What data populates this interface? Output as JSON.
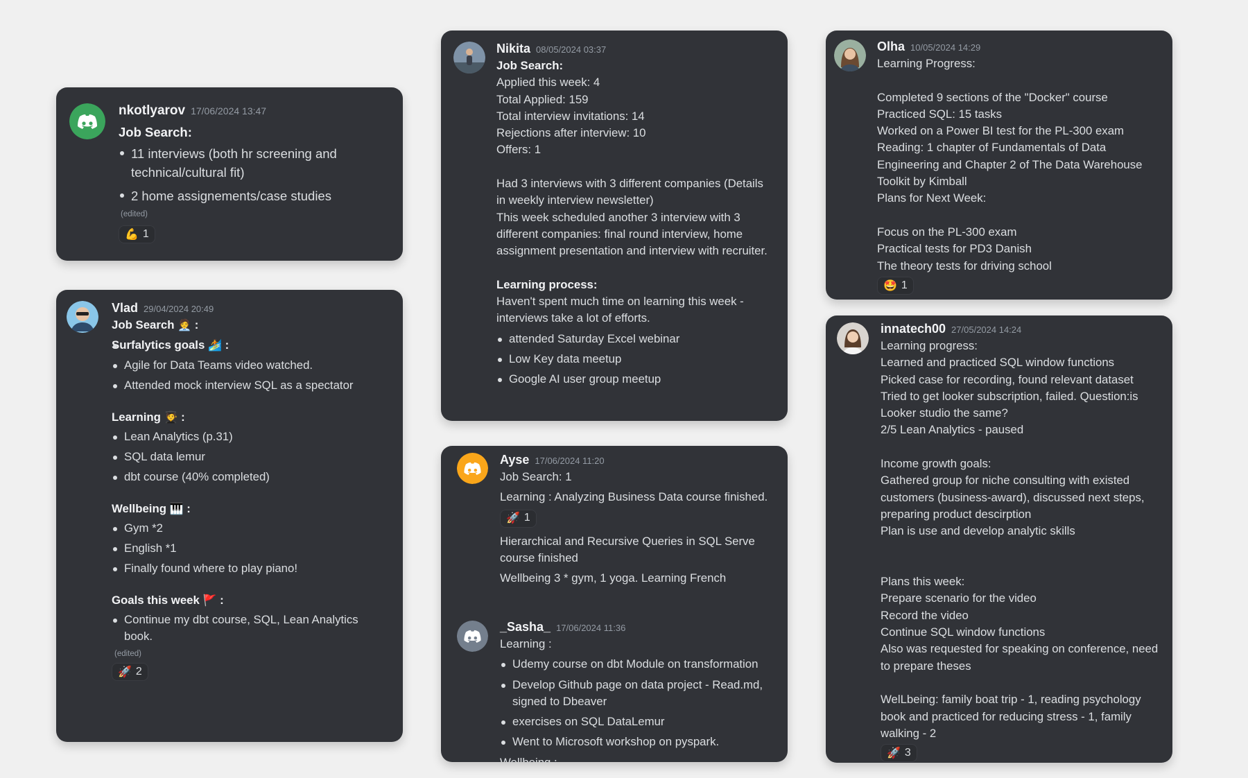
{
  "cards": {
    "nk": {
      "user": "nkotlyarov",
      "time": "17/06/2024 13:47",
      "heading": "Job Search:",
      "items": [
        "11 interviews (both hr screening and technical/cultural fit)",
        "2 home assignements/case studies"
      ],
      "edited": "(edited)",
      "reaction": {
        "emoji": "💪",
        "count": "1"
      }
    },
    "vlad": {
      "user": "Vlad",
      "time": "29/04/2024 20:49",
      "job_heading": "Job Search",
      "job_emoji": "🧑‍💼",
      "colon": ":",
      "surf_heading": "Surfalytics goals",
      "surf_emoji": "🏄",
      "surf_items": [
        "Agile for Data Teams video watched.",
        "Attended mock interview SQL as a spectator"
      ],
      "learn_heading": "Learning",
      "learn_emoji": "🧑‍🎓",
      "learn_items": [
        "Lean Analytics (p.31)",
        "SQL data lemur",
        "dbt course (40% completed)"
      ],
      "well_heading": "Wellbeing",
      "well_emoji": "🎹",
      "well_items": [
        "Gym *2",
        "English *1",
        "Finally found where to play piano!"
      ],
      "goals_heading": "Goals this week",
      "goals_emoji": "🚩",
      "goals_items": [
        "Continue my dbt course, SQL, Lean Analytics book."
      ],
      "edited": "(edited)",
      "reaction": {
        "emoji": "🚀",
        "count": "2"
      }
    },
    "nikita": {
      "user": "Nikita",
      "time": "08/05/2024 03:37",
      "heading": "Job Search:",
      "lines": [
        "Applied this week: 4",
        "Total Applied: 159",
        "Total interview invitations: 14",
        "Rejections after interview: 10",
        "Offers: 1"
      ],
      "para1": "Had 3 interviews with 3 different companies (Details in weekly interview newsletter)",
      "para2": "This week scheduled another 3 interview with 3 different companies: final round interview, home assignment presentation and interview with recruiter.",
      "learn_heading": "Learning process:",
      "learn_text": "Haven't spent much time on learning this week - interviews take a lot of efforts.",
      "items": [
        "attended Saturday Excel webinar",
        "Low Key data meetup",
        "Google AI user group meetup"
      ]
    },
    "olha": {
      "user": "Olha",
      "time": "10/05/2024 14:29",
      "lines": [
        "Learning Progress:",
        "",
        "Completed 9 sections of the \"Docker\" course",
        "Practiced SQL: 15 tasks",
        "Worked on a Power BI test for the PL-300 exam",
        "Reading: 1 chapter of Fundamentals of Data Engineering and Chapter 2 of The Data Warehouse Toolkit by Kimball",
        "Plans for Next Week:",
        "",
        "Focus on the PL-300 exam",
        "Practical tests for PD3 Danish",
        "The theory tests for driving school"
      ],
      "reaction": {
        "emoji": "🤩",
        "count": "1"
      }
    },
    "ayse": {
      "user": "Ayse",
      "time": "17/06/2024 11:20",
      "line1": "Job Search: 1",
      "line2": "Learning : Analyzing Business Data course finished.",
      "reaction": {
        "emoji": "🚀",
        "count": "1"
      },
      "line3": "Hierarchical and Recursive Queries in SQL Serve course finished",
      "line4": "Wellbeing 3 * gym, 1 yoga. Learning French"
    },
    "sasha": {
      "user": "_Sasha_",
      "time": "17/06/2024 11:36",
      "heading": "Learning :",
      "items": [
        "Udemy course on dbt Module on transformation",
        "Develop Github page on  data project - Read.md, signed to Dbeaver",
        "exercises on SQL DataLemur",
        "Went to Microsoft workshop on pyspark."
      ],
      "tail": "Wellbeing :"
    },
    "inna": {
      "user": "innatech00",
      "time": "27/05/2024 14:24",
      "lines": [
        "Learning progress:",
        "Learned and practiced SQL window functions",
        "Picked case for recording, found relevant dataset",
        "Tried to get looker subscription, failed. Question:is Looker studio the same?",
        "2/5 Lean Analytics - paused",
        "",
        "Income growth goals:",
        "Gathered group for niche consulting with existed customers (business-award), discussed next steps, preparing product descirption",
        "Plan is use and develop analytic skills",
        "",
        "",
        "Plans this week:",
        "Prepare scenario for the video",
        "Record the video",
        "Continue SQL window functions",
        "Also was requested for speaking on conference, need to prepare theses",
        "",
        "WelLbeing: family boat trip - 1, reading psychology book and practiced for reducing stress - 1, family walking - 2"
      ],
      "reaction": {
        "emoji": "🚀",
        "count": "3"
      }
    }
  }
}
